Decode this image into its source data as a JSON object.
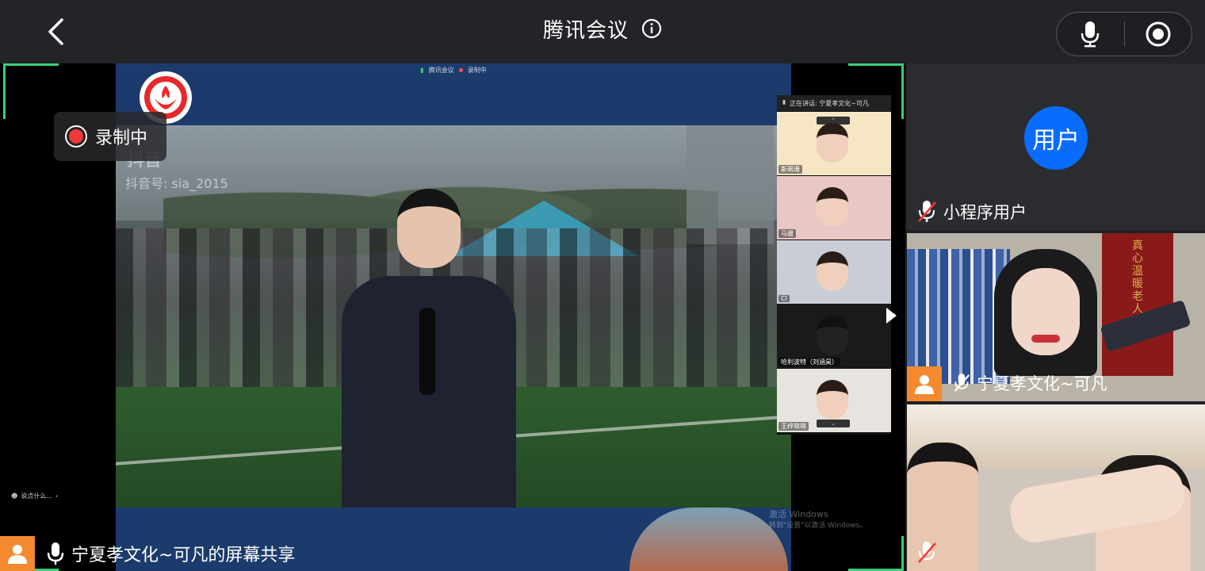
{
  "header": {
    "title": "腾讯会议",
    "icons": {
      "back": "chevron-left-icon",
      "info": "info-icon",
      "mic": "microphone-icon",
      "record": "record-icon"
    }
  },
  "recording": {
    "label": "录制中",
    "color": "#f03a3a"
  },
  "share": {
    "label": "宁夏孝文化~可凡的屏幕共享",
    "inner_topbar": {
      "app": "腾讯会议",
      "status": "录制中"
    },
    "watermark_app": "抖音",
    "watermark_id": "抖音号: sia_2015",
    "speaking": "正在讲话: 宁夏孝文化~可凡",
    "strip_participants": [
      {
        "name": "斯珮珊"
      },
      {
        "name": "马媛"
      },
      {
        "name": "CI"
      },
      {
        "name": "哈利波特（刘涵昊）"
      },
      {
        "name": "王梓萌萌"
      }
    ],
    "left_hint": "说点什么...",
    "windows_notice_line1": "激活 Windows",
    "windows_notice_line2": "转到\"设置\"以激活 Windows。"
  },
  "participants": [
    {
      "avatar_text": "用户",
      "name": "小程序用户",
      "muted": true,
      "avatar_color": "#0a6cff"
    },
    {
      "name": "宁夏孝文化~可凡",
      "muted": true,
      "banner_text": "真心温暖老人心"
    },
    {
      "name": "",
      "muted": true
    }
  ],
  "colors": {
    "accent_green": "#3bcf7b",
    "avatar_orange": "#f48a2f",
    "avatar_blue": "#0a6cff"
  }
}
